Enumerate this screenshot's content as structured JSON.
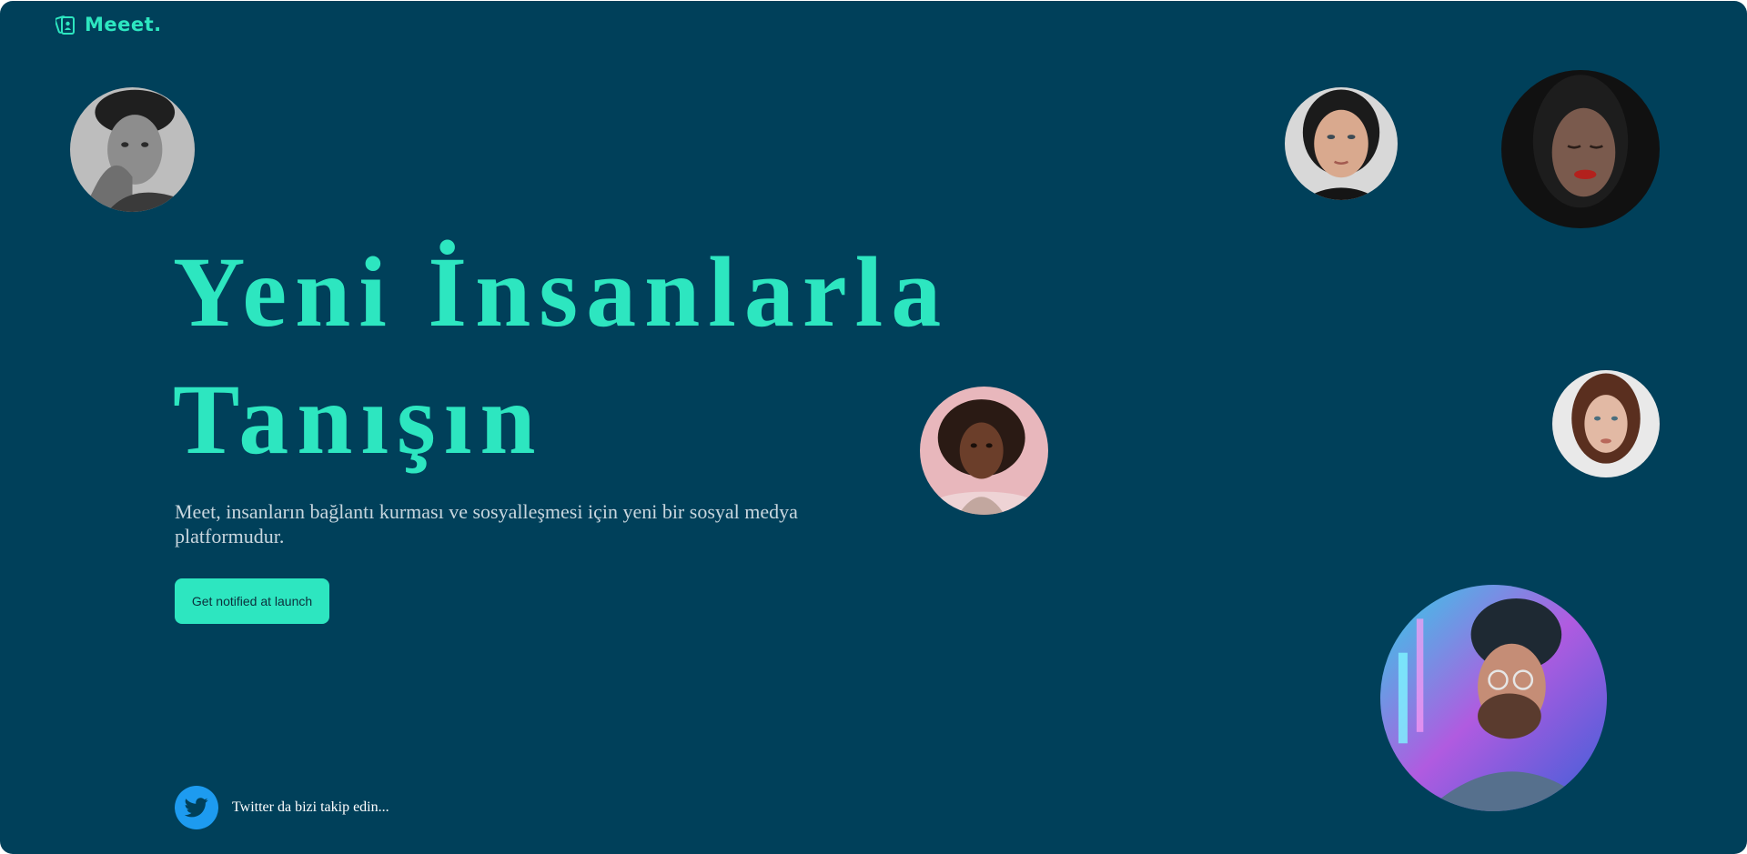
{
  "brand": {
    "name": "Meeet.",
    "icon": "cards-icon",
    "accent_color": "#2de6c0",
    "background_color": "#00405a"
  },
  "hero": {
    "title_line1": "Yeni İnsanlarla",
    "title_line2": "Tanışın",
    "subtitle": "Meet, insanların bağlantı kurması ve sosyalleşmesi için yeni bir sosyal medya platformudur.",
    "cta_label": "Get notified at launch"
  },
  "social": {
    "icon": "twitter-icon",
    "label": "Twitter da bizi takip edin..."
  },
  "avatars": [
    {
      "name": "avatar-man-monochrome"
    },
    {
      "name": "avatar-woman-dark-hair"
    },
    {
      "name": "avatar-woman-red-lips"
    },
    {
      "name": "avatar-woman-curly-hair"
    },
    {
      "name": "avatar-woman-auburn-hair"
    },
    {
      "name": "avatar-man-neon-beanie"
    }
  ]
}
